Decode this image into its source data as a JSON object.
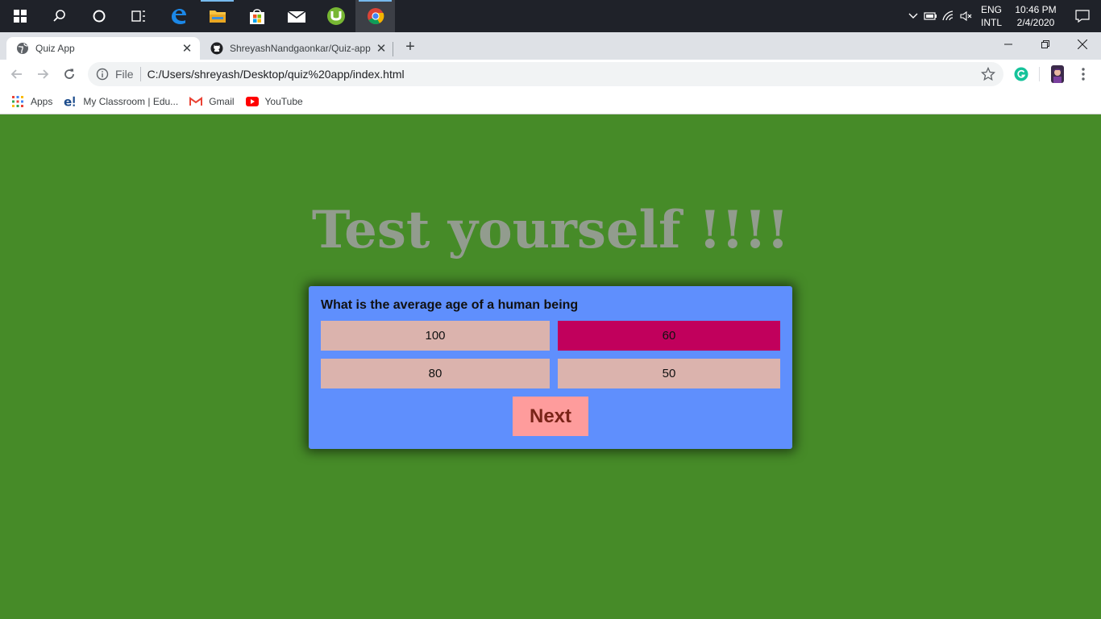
{
  "taskbar": {
    "lang_top": "ENG",
    "lang_bottom": "INTL",
    "time": "10:46 PM",
    "date": "2/4/2020"
  },
  "browser": {
    "tabs": [
      {
        "title": "Quiz App",
        "active": true
      },
      {
        "title": "ShreyashNandgaonkar/Quiz-app",
        "active": false
      }
    ],
    "url_prefix": "File",
    "url": "C:/Users/shreyash/Desktop/quiz%20app/index.html",
    "bookmarks": [
      {
        "label": "Apps"
      },
      {
        "label": "My Classroom | Edu..."
      },
      {
        "label": "Gmail"
      },
      {
        "label": "YouTube"
      }
    ]
  },
  "page": {
    "heading": "Test yourself !!!!",
    "question": "What is the average age of a human being",
    "options": [
      {
        "label": "100",
        "selected": false
      },
      {
        "label": "60",
        "selected": true
      },
      {
        "label": "80",
        "selected": false
      },
      {
        "label": "50",
        "selected": false
      }
    ],
    "next_label": "Next"
  },
  "colors": {
    "page_background": "#468b28",
    "heading": "#929c8e",
    "card": "#5f8ffd",
    "option": "#dbb3ad",
    "option_selected": "#c1005c",
    "next_button": "#fe9c9c",
    "next_text": "#7a2418"
  }
}
